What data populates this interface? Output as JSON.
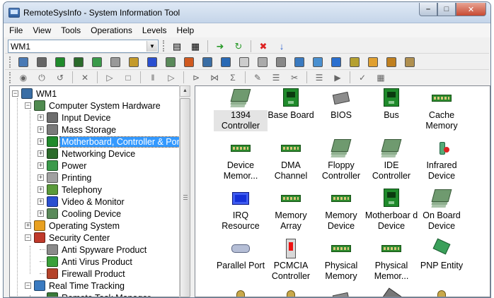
{
  "window": {
    "title": "RemoteSysInfo - System Information Tool"
  },
  "menu": [
    "File",
    "View",
    "Tools",
    "Operations",
    "Levels",
    "Help"
  ],
  "computer_combo": {
    "value": "WM1"
  },
  "toolbar_icons": {
    "row1": [
      "scan-icon",
      "network-icon",
      "connect-icon",
      "refresh-green-icon",
      "stop-icon",
      "info-icon"
    ],
    "row2": [
      "computer-icon",
      "cpu-icon",
      "board-icon",
      "card-icon",
      "tree-icon",
      "printer-icon",
      "pen-icon",
      "minus-icon",
      "stack-icon",
      "face-icon",
      "monitor-icon",
      "transfer-icon",
      "doc-icon",
      "docs-icon",
      "print-doc-icon",
      "user-icon",
      "window-icon",
      "cube-icon",
      "gear-box-icon",
      "bag-icon",
      "gear-icon",
      "app-icon"
    ],
    "row3": [
      "record-icon",
      "power-icon",
      "restart-icon",
      "cancel-icon",
      "play-icon",
      "stop-square-icon",
      "pause-icon",
      "next-icon",
      "skip-icon",
      "end-icon",
      "sum-icon",
      "edit-icon",
      "list-icon",
      "scissors-icon",
      "page-icon",
      "play-circle-icon",
      "check-icon",
      "calc-icon"
    ]
  },
  "tree": [
    {
      "label": "WM1",
      "level": 0,
      "expander": "−",
      "icon": "computer-icon",
      "color": "#3a6ea5"
    },
    {
      "label": "Computer System Hardware",
      "level": 1,
      "expander": "−",
      "icon": "hardware-icon",
      "color": "#4f8a4f"
    },
    {
      "label": "Input Device",
      "level": 2,
      "expander": "+",
      "icon": "keyboard-icon",
      "color": "#6d6d6d"
    },
    {
      "label": "Mass Storage",
      "level": 2,
      "expander": "+",
      "icon": "storage-icon",
      "color": "#7a7a7a"
    },
    {
      "label": "Motherboard, Controller & Port",
      "level": 2,
      "expander": "+",
      "icon": "motherboard-icon",
      "color": "#1f8a2b",
      "selected": true
    },
    {
      "label": "Networking Device",
      "level": 2,
      "expander": "+",
      "icon": "network-card-icon",
      "color": "#2b6b2b"
    },
    {
      "label": "Power",
      "level": 2,
      "expander": "+",
      "icon": "power-icon",
      "color": "#3a9a4a"
    },
    {
      "label": "Printing",
      "level": 2,
      "expander": "+",
      "icon": "printer-icon",
      "color": "#a0a0a0"
    },
    {
      "label": "Telephony",
      "level": 2,
      "expander": "+",
      "icon": "phone-icon",
      "color": "#5a9a3a"
    },
    {
      "label": "Video & Monitor",
      "level": 2,
      "expander": "+",
      "icon": "video-card-icon",
      "color": "#2a4fd0"
    },
    {
      "label": "Cooling Device",
      "level": 2,
      "expander": "+",
      "icon": "fan-icon",
      "color": "#5a8a5a"
    },
    {
      "label": "Operating System",
      "level": 1,
      "expander": "+",
      "icon": "windows-icon",
      "color": "#e8a020"
    },
    {
      "label": "Security Center",
      "level": 1,
      "expander": "−",
      "icon": "shield-icon",
      "color": "#c0392b"
    },
    {
      "label": "Anti Spyware Product",
      "level": 2,
      "expander": "",
      "icon": "spyware-icon",
      "color": "#8a8a8a"
    },
    {
      "label": "Anti Virus Product",
      "level": 2,
      "expander": "",
      "icon": "check-shield-icon",
      "color": "#3aa03a"
    },
    {
      "label": "Firewall Product",
      "level": 2,
      "expander": "",
      "icon": "firewall-icon",
      "color": "#b5432a"
    },
    {
      "label": "Real Time Tracking",
      "level": 1,
      "expander": "−",
      "icon": "tracking-icon",
      "color": "#3a7ac0"
    },
    {
      "label": "Remote Task Manager",
      "level": 2,
      "expander": "",
      "icon": "task-manager-icon",
      "color": "#3a7a3a"
    }
  ],
  "device_grid": [
    {
      "label": "1394 Controller",
      "icon": "controller-icon",
      "art": "i-stack",
      "selected": true
    },
    {
      "label": "Base Board",
      "icon": "base-board-icon",
      "art": "i-board"
    },
    {
      "label": "BIOS",
      "icon": "bios-chip-icon",
      "art": "i-chip"
    },
    {
      "label": "Bus",
      "icon": "bus-icon",
      "art": "i-board"
    },
    {
      "label": "Cache Memory",
      "icon": "memory-icon",
      "art": "i-mem"
    },
    {
      "label": "Device Memor...",
      "icon": "memory-icon",
      "art": "i-mem"
    },
    {
      "label": "DMA Channel",
      "icon": "memory-icon",
      "art": "i-mem"
    },
    {
      "label": "Floppy Controller",
      "icon": "controller-icon",
      "art": "i-stack"
    },
    {
      "label": "IDE Controller",
      "icon": "controller-icon",
      "art": "i-stack"
    },
    {
      "label": "Infrared Device",
      "icon": "infrared-icon",
      "art": "i-plug"
    },
    {
      "label": "IRQ Resource",
      "icon": "irq-icon",
      "art": "i-irq"
    },
    {
      "label": "Memory Array",
      "icon": "memory-icon",
      "art": "i-mem"
    },
    {
      "label": "Memory Device",
      "icon": "memory-icon",
      "art": "i-mem"
    },
    {
      "label": "Motherboar d Device",
      "icon": "motherboard-icon",
      "art": "i-board"
    },
    {
      "label": "On Board Device",
      "icon": "controller-icon",
      "art": "i-stack"
    },
    {
      "label": "Parallel Port",
      "icon": "port-icon",
      "art": "i-port"
    },
    {
      "label": "PCMCIA Controller",
      "icon": "pcmcia-icon",
      "art": "i-pcmcia"
    },
    {
      "label": "Physical Memory",
      "icon": "memory-icon",
      "art": "i-mem"
    },
    {
      "label": "Physical Memor...",
      "icon": "memory-icon",
      "art": "i-mem"
    },
    {
      "label": "PNP Entity",
      "icon": "pnp-icon",
      "art": "i-pnp"
    },
    {
      "label": "",
      "icon": "connector-icon",
      "art": "i-bell"
    },
    {
      "label": "",
      "icon": "connector-icon",
      "art": "i-bell"
    },
    {
      "label": "",
      "icon": "processor-icon",
      "art": "i-chip"
    },
    {
      "label": "",
      "icon": "slot-icon",
      "art": "i-grey"
    },
    {
      "label": "",
      "icon": "connector-icon",
      "art": "i-bell"
    }
  ]
}
